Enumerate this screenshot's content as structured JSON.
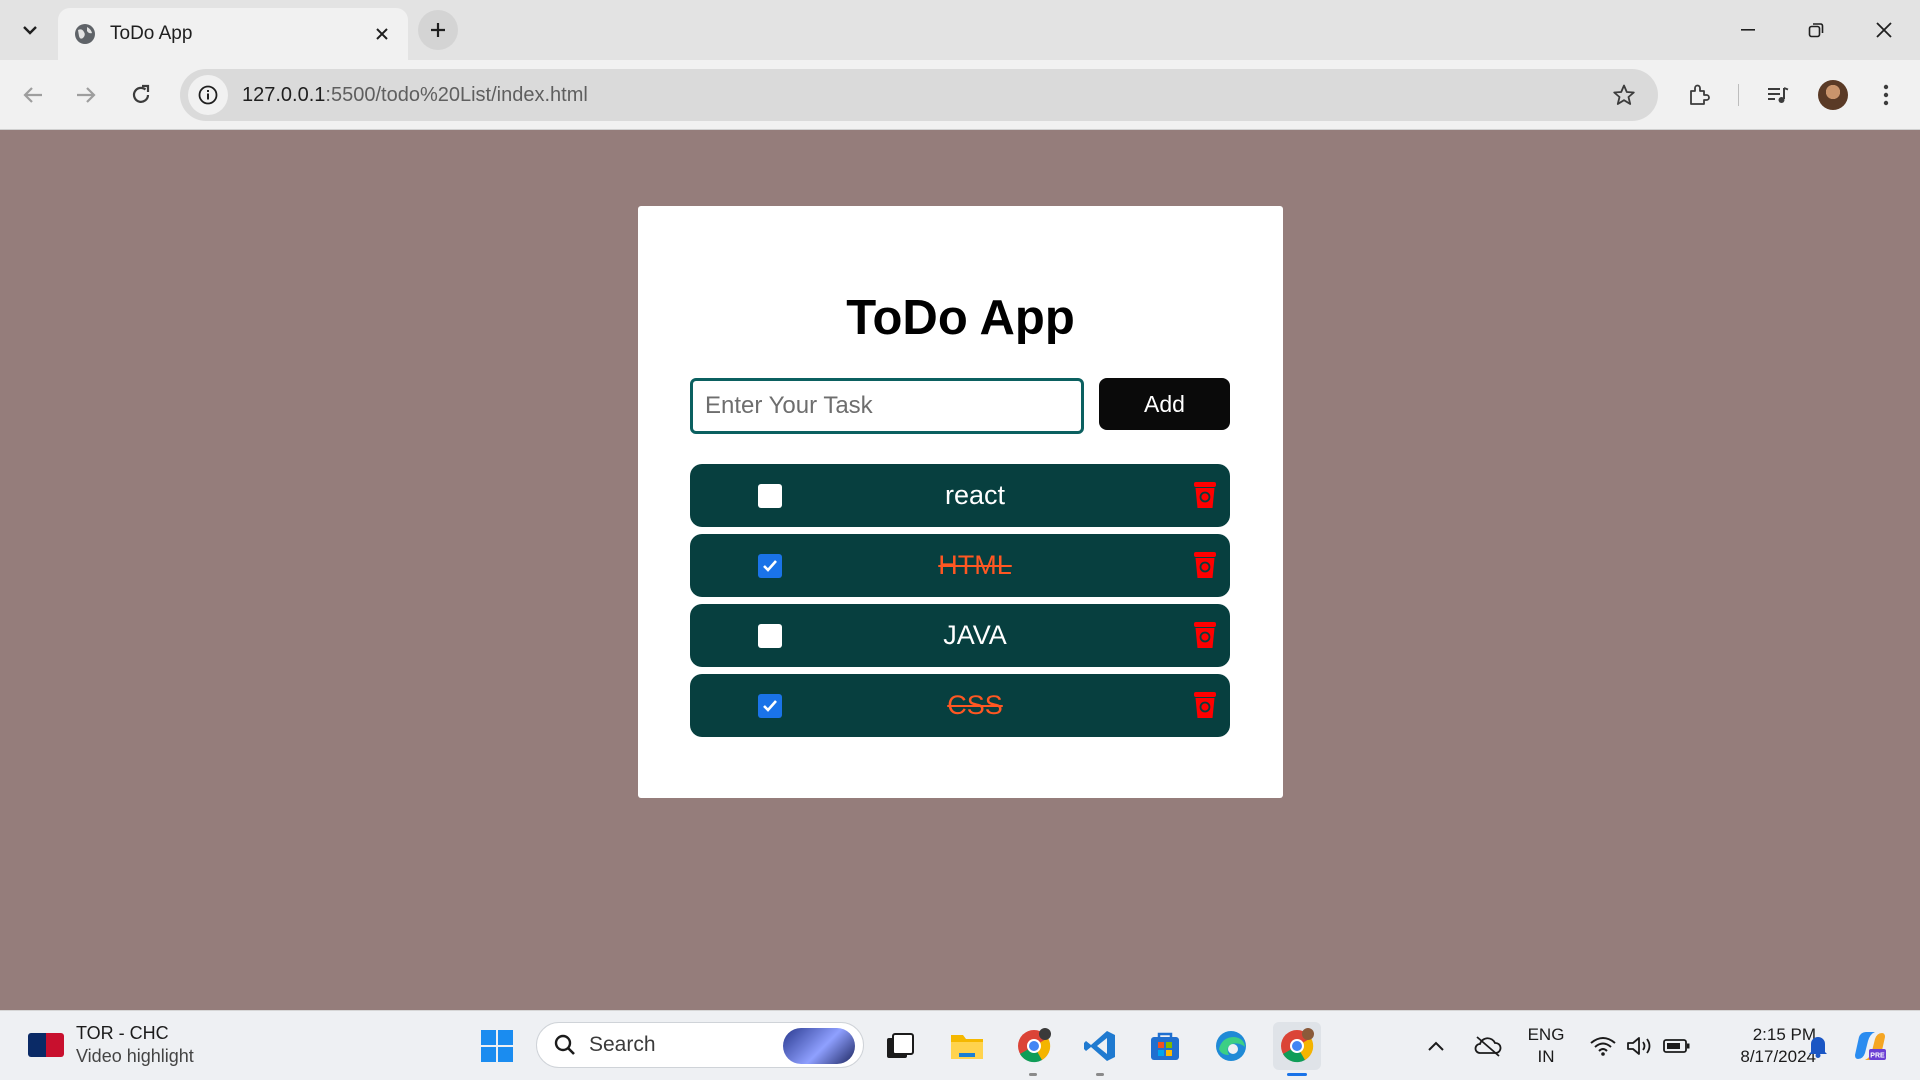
{
  "browser": {
    "tab_title": "ToDo App",
    "url_host": "127.0.0.1",
    "url_rest": ":5500/todo%20List/index.html"
  },
  "app": {
    "title": "ToDo App",
    "input_placeholder": "Enter Your Task",
    "add_label": "Add",
    "tasks": [
      {
        "text": "react",
        "completed": false
      },
      {
        "text": "HTML",
        "completed": true
      },
      {
        "text": "JAVA",
        "completed": false
      },
      {
        "text": "CSS",
        "completed": true
      }
    ],
    "colors": {
      "page_bg": "#957d7b",
      "item_bg": "#073f3f",
      "done_text": "#ff5722",
      "trash": "#ff0000"
    }
  },
  "taskbar": {
    "news_title": "TOR - CHC",
    "news_subtitle": "Video highlight",
    "search_label": "Search",
    "lang_top": "ENG",
    "lang_bottom": "IN",
    "time": "2:15 PM",
    "date": "8/17/2024"
  }
}
